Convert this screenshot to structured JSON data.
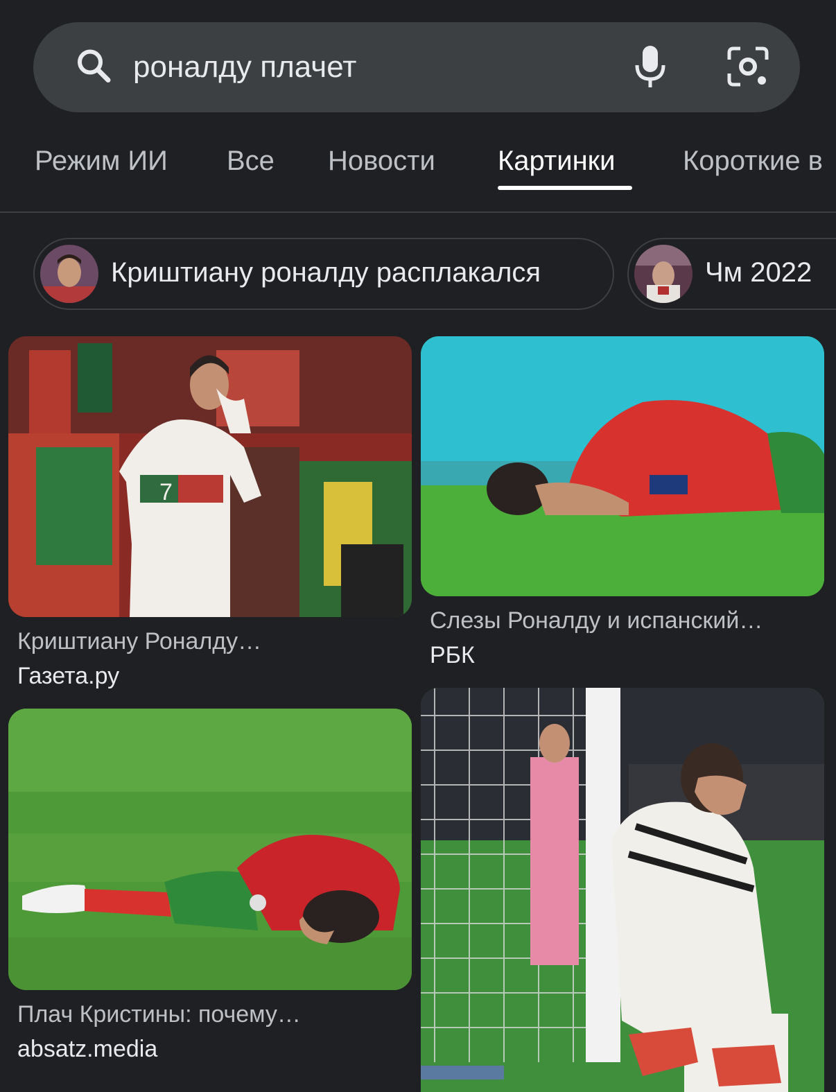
{
  "search": {
    "query": "роналду плачет",
    "icons": [
      "search-icon",
      "mic-icon",
      "camera-lens-icon"
    ]
  },
  "tabs": [
    {
      "label": "Режим ИИ"
    },
    {
      "label": "Все"
    },
    {
      "label": "Новости"
    },
    {
      "label": "Картинки",
      "active": true
    },
    {
      "label": "Короткие в"
    }
  ],
  "chips": [
    {
      "label": "Криштиану роналду расплакался"
    },
    {
      "label": "Чм 2022"
    }
  ],
  "results": [
    {
      "title": "Криштиану Роналду…",
      "source": "Газета.ру"
    },
    {
      "title": "Слезы Роналду и испанский…",
      "source": "РБК"
    },
    {
      "title": "Плач Кристины: почему…",
      "source": "absatz.media"
    },
    {
      "title": "",
      "source": ""
    }
  ],
  "colors": {
    "background": "#1f2023",
    "searchbar": "#3c4043",
    "text_primary": "#e8eaed",
    "text_secondary": "#bdc1c6",
    "tab_active_underline": "#ffffff"
  }
}
